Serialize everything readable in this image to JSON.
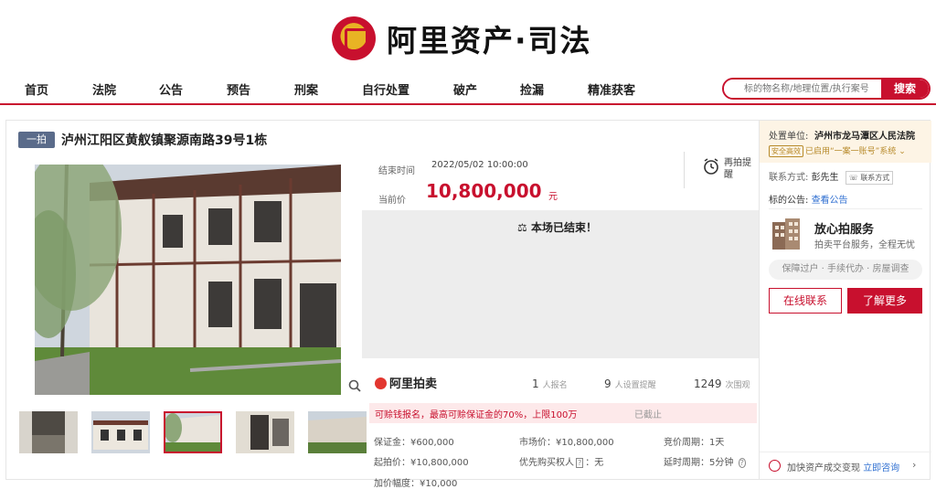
{
  "brand": "阿里资产·司法",
  "nav": [
    "首页",
    "法院",
    "公告",
    "预告",
    "刑案",
    "自行处置",
    "破产",
    "捡漏",
    "精准获客"
  ],
  "search": {
    "placeholder": "标的物名称/地理位置/执行案号",
    "button": "搜索"
  },
  "listing": {
    "tag": "一拍",
    "title": "泸州江阳区黄舣镇聚源南路39号1栋",
    "end_label": "结束时间",
    "end_time": "2022/05/02 10:00:00",
    "price_label": "当前价",
    "price": "10,800,000",
    "price_unit": "元",
    "remind": "再拍提醒",
    "ended": "本场已结束！",
    "ali_brand": "阿里拍卖",
    "stats": [
      {
        "num": "1",
        "label": "人报名"
      },
      {
        "num": "9",
        "label": "人设置提醒"
      },
      {
        "num": "1249",
        "label": "次围观"
      }
    ],
    "warning": "可赊钱报名，最高可赊保证金的70%，上限100万",
    "warning_status": "已截止",
    "details": {
      "deposit": "保证金：¥600,000",
      "market_price": "市场价：¥10,800,000",
      "cycle": "竞价周期：1天",
      "start_price": "起拍价：¥10,800,000",
      "priority_label": "优先购买权人",
      "priority_value": "：无",
      "extend": "延时周期：5分钟",
      "increment": "加价幅度：¥10,000"
    }
  },
  "sidebar": {
    "unit_label": "处置单位:",
    "unit": "泸州市龙马潭区人民法院",
    "safety_badge": "安全高效",
    "safety_text": "已启用“一案一账号”系统",
    "contact_label": "联系方式:",
    "contact_name": "彭先生",
    "contact_btn": "联系方式",
    "notice_label": "标的公告:",
    "notice_link": "查看公告",
    "service_title": "放心拍服务",
    "service_desc": "拍卖平台服务，全程无忧",
    "service_pill": "保障过户 · 手续代办 · 房屋调查",
    "btn_online": "在线联系",
    "btn_more": "了解更多",
    "footer_text": "加快资产成交变现",
    "footer_link": "立即咨询"
  },
  "colors": {
    "accent": "#c8102e",
    "link": "#2f6fd1"
  }
}
